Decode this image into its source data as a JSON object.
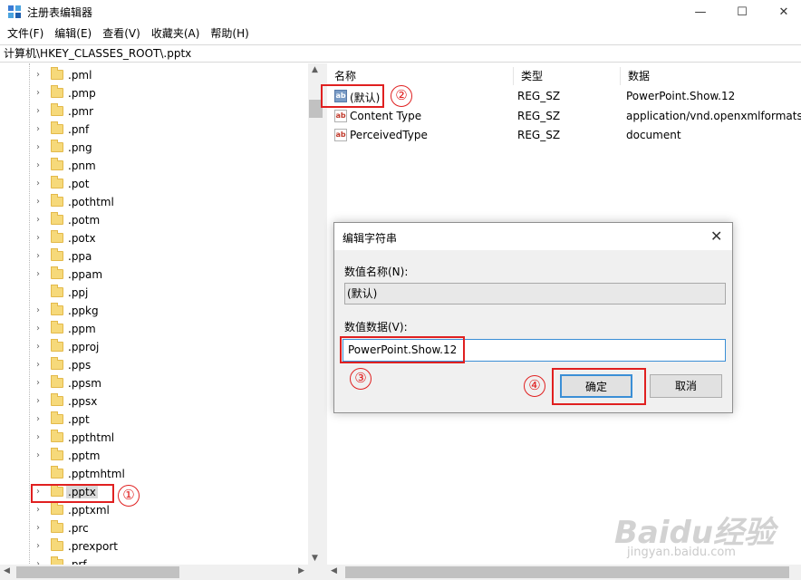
{
  "window": {
    "title": "注册表编辑器",
    "minimize": "—",
    "maximize": "☐",
    "close": "✕"
  },
  "menu": [
    "文件(F)",
    "编辑(E)",
    "查看(V)",
    "收藏夹(A)",
    "帮助(H)"
  ],
  "address": "计算机\\HKEY_CLASSES_ROOT\\.pptx",
  "tree": {
    "items": [
      ".pml",
      ".pmp",
      ".pmr",
      ".pnf",
      ".png",
      ".pnm",
      ".pot",
      ".pothtml",
      ".potm",
      ".potx",
      ".ppa",
      ".ppam",
      ".ppj",
      ".ppkg",
      ".ppm",
      ".pproj",
      ".pps",
      ".ppsm",
      ".ppsx",
      ".ppt",
      ".ppthtml",
      ".pptm",
      ".pptmhtml",
      ".pptx",
      ".pptxml",
      ".prc",
      ".prexport",
      ".prf"
    ],
    "has_chevron": [
      true,
      true,
      true,
      true,
      true,
      true,
      true,
      true,
      true,
      true,
      true,
      true,
      false,
      true,
      true,
      true,
      true,
      true,
      true,
      true,
      true,
      true,
      false,
      true,
      true,
      true,
      true,
      true
    ],
    "selected": ".pptx"
  },
  "values": {
    "headers": [
      "名称",
      "类型",
      "数据"
    ],
    "rows": [
      {
        "name": "(默认)",
        "type": "REG_SZ",
        "data": "PowerPoint.Show.12"
      },
      {
        "name": "Content Type",
        "type": "REG_SZ",
        "data": "application/vnd.openxmlformats-"
      },
      {
        "name": "PerceivedType",
        "type": "REG_SZ",
        "data": "document"
      }
    ]
  },
  "dialog": {
    "title": "编辑字符串",
    "name_label": "数值名称(N):",
    "name_value": "(默认)",
    "data_label": "数值数据(V):",
    "data_value": "PowerPoint.Show.12",
    "ok_label": "确定",
    "cancel_label": "取消"
  },
  "annotations": [
    "①",
    "②",
    "③",
    "④"
  ],
  "watermark": {
    "brand": "Baidu经验",
    "url": "jingyan.baidu.com"
  },
  "colors": {
    "annotation": "#e02020",
    "accent": "#3b8fd6",
    "folder": "#f6d97a"
  }
}
